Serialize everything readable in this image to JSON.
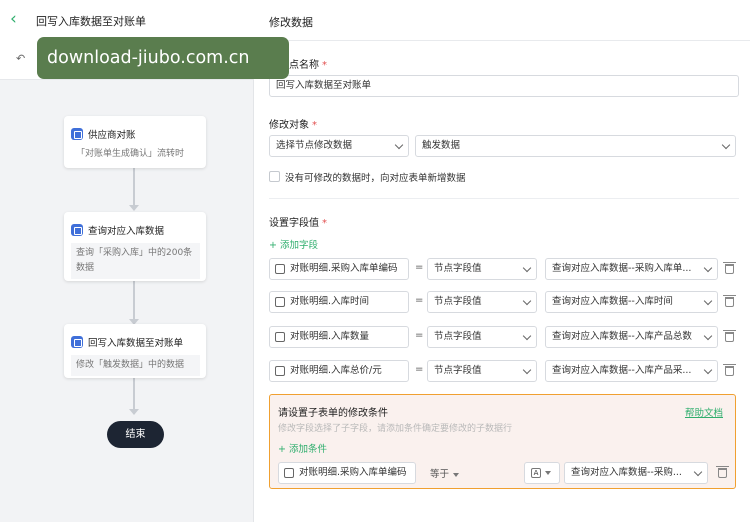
{
  "header": {
    "back_icon": "chevron-left-icon",
    "flow_title": "回写入库数据至对账单"
  },
  "watermark": "download-jiubo.com.cn",
  "flow": {
    "nodes": [
      {
        "title": "供应商对账",
        "desc": "「对账单生成确认」流转时"
      },
      {
        "title": "查询对应入库数据",
        "desc": "查询「采购入库」中的200条数据"
      },
      {
        "title": "回写入库数据至对账单",
        "desc": "修改「触发数据」中的数据"
      }
    ],
    "end_label": "结束"
  },
  "panel": {
    "title": "修改数据",
    "node_name_label": "点名称",
    "node_name_value": "回写入库数据至对账单",
    "modify_target_label": "修改对象",
    "modify_target_select1": "选择节点修改数据",
    "modify_target_select2": "触发数据",
    "checkbox_label": "没有可修改的数据时，向对应表单新增数据",
    "set_fields_label": "设置字段值",
    "add_field_label": "+ 添加字段",
    "eq": "=",
    "rows": [
      {
        "field": "对账明细.采购入库单编码",
        "mode": "节点字段值",
        "value": "查询对应入库数据--采购入库单..."
      },
      {
        "field": "对账明细.入库时间",
        "mode": "节点字段值",
        "value": "查询对应入库数据--入库时间"
      },
      {
        "field": "对账明细.入库数量",
        "mode": "节点字段值",
        "value": "查询对应入库数据--入库产品总数"
      },
      {
        "field": "对账明细.入库总价/元",
        "mode": "节点字段值",
        "value": "查询对应入库数据--入库产品采..."
      }
    ],
    "condition": {
      "title": "请设置子表单的修改条件",
      "help": "帮助文档",
      "hint": "修改字段选择了子字段，请添加条件确定要修改的子数据行",
      "add_condition_label": "+ 添加条件",
      "field": "对账明细.采购入库单编码",
      "operator": "等于",
      "type_badge": "A",
      "value": "查询对应入库数据--采购..."
    }
  },
  "colors": {
    "accent": "#2fae6d",
    "highlight_border": "#f0a030",
    "end_node": "#1d2533"
  }
}
